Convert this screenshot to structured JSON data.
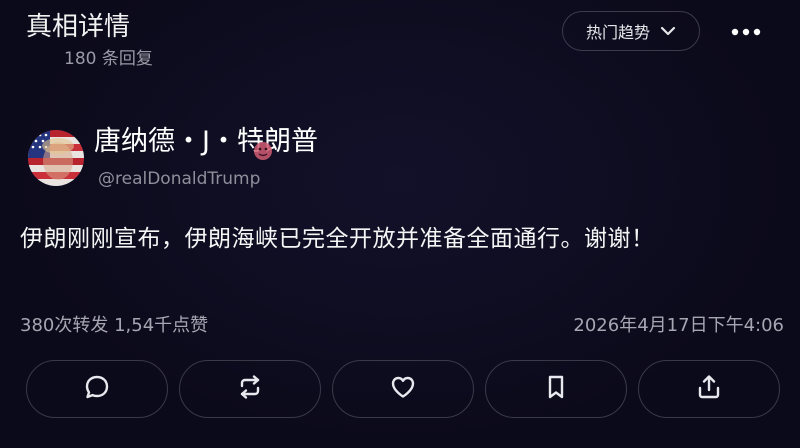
{
  "header": {
    "title": "真相详情",
    "reply_count": "180 条回复",
    "trend_button_label": "热门趋势",
    "more_icon": "more-horizontal-icon"
  },
  "post": {
    "author_name": "唐纳德・J・特朗普",
    "handle": "@realDonaldTrump",
    "body": "伊朗刚刚宣布，伊朗海峡已完全开放并准备全面通行。谢谢！",
    "stats": "380次转发 1,54千点赞",
    "timestamp": "2026年4月17日下午4:06"
  },
  "actions": [
    {
      "icon": "comment-icon"
    },
    {
      "icon": "repost-icon"
    },
    {
      "icon": "like-icon"
    },
    {
      "icon": "bookmark-icon"
    },
    {
      "icon": "share-icon"
    }
  ],
  "colors": {
    "background": "#0b0a1a",
    "muted_text": "#9a9aa6",
    "border": "#3a3948"
  }
}
